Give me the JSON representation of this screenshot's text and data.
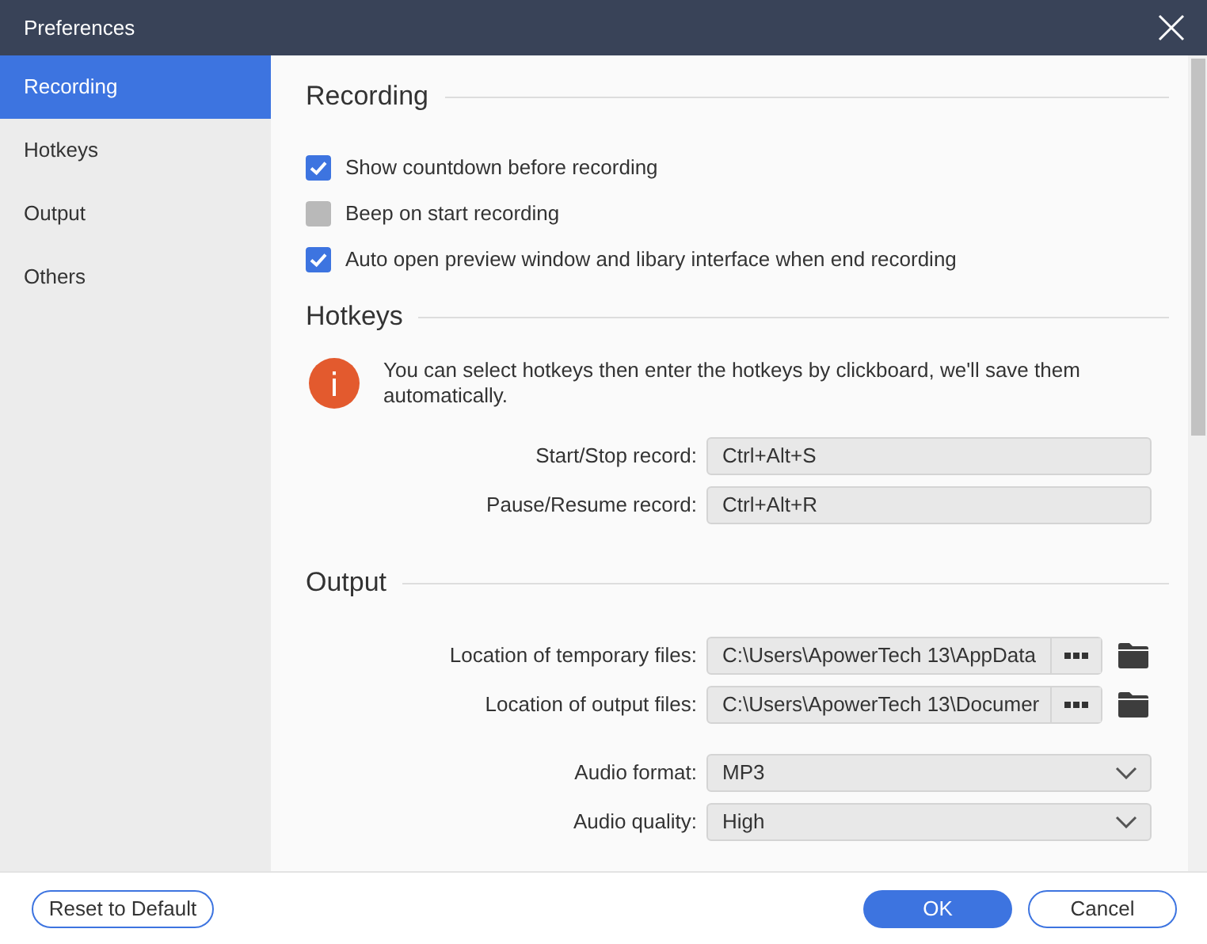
{
  "window": {
    "title": "Preferences"
  },
  "sidebar": {
    "items": [
      {
        "label": "Recording",
        "selected": true
      },
      {
        "label": "Hotkeys",
        "selected": false
      },
      {
        "label": "Output",
        "selected": false
      },
      {
        "label": "Others",
        "selected": false
      }
    ]
  },
  "sections": [
    {
      "kind": "checkboxes",
      "title": "Recording",
      "options": [
        {
          "label": "Show countdown before recording",
          "checked": true
        },
        {
          "label": "Beep on start recording",
          "checked": false
        },
        {
          "label": "Auto open preview window and libary interface when end recording",
          "checked": true
        }
      ]
    },
    {
      "kind": "hotkeys",
      "title": "Hotkeys",
      "info": "You can select hotkeys then enter the hotkeys by clickboard, we'll save them automatically.",
      "fields": [
        {
          "label": "Start/Stop record:",
          "value": "Ctrl+Alt+S"
        },
        {
          "label": "Pause/Resume record:",
          "value": "Ctrl+Alt+R"
        }
      ]
    },
    {
      "kind": "output",
      "title": "Output",
      "fields": [
        {
          "kind": "path",
          "label": "Location of temporary files:",
          "value": "C:\\Users\\ApowerTech 13\\AppData"
        },
        {
          "kind": "path",
          "label": "Location of output files:",
          "value": "C:\\Users\\ApowerTech 13\\Documer"
        },
        {
          "kind": "dropdown",
          "label": "Audio format:",
          "value": "MP3"
        },
        {
          "kind": "dropdown",
          "label": "Audio quality:",
          "value": "High"
        }
      ]
    }
  ],
  "footer": {
    "reset": "Reset to Default",
    "ok": "OK",
    "cancel": "Cancel"
  }
}
